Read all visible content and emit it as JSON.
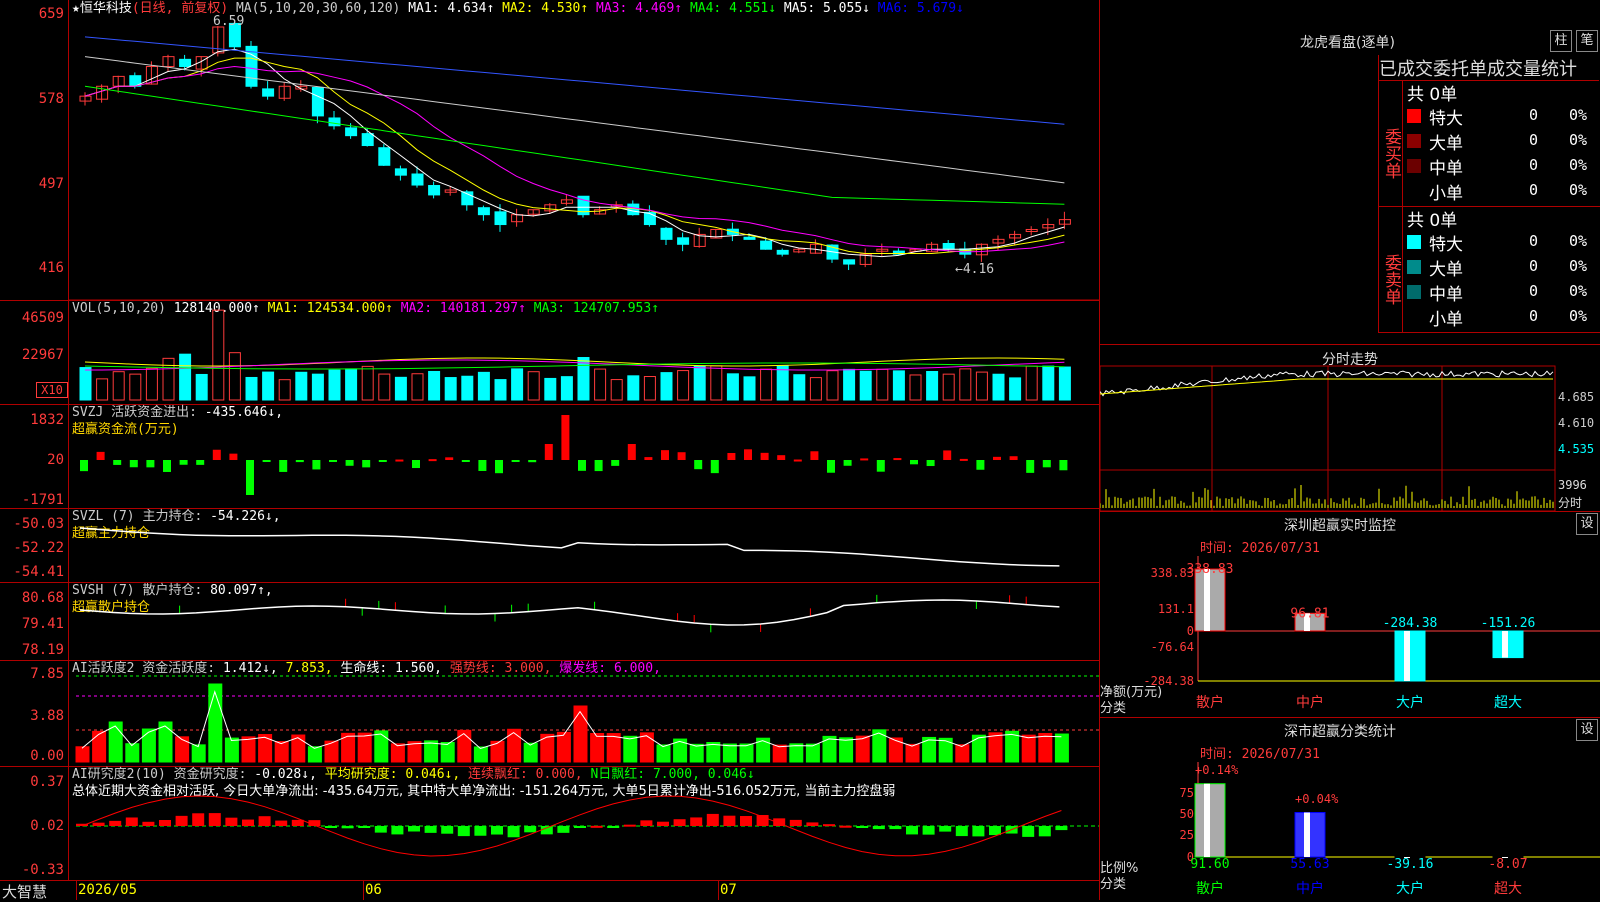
{
  "stock": {
    "marker": "★",
    "name": "恒华科技",
    "mode": "(日线, 前复权)"
  },
  "kline": {
    "high_label": "6.59",
    "low_label": "←4.16",
    "ma_hdr": "MA(5,10,20,30,60,120)",
    "ma": [
      {
        "k": "MA1:",
        "v": "4.634↑",
        "c": "#ffffff"
      },
      {
        "k": "MA2:",
        "v": "4.530↑",
        "c": "#ffff00"
      },
      {
        "k": "MA3:",
        "v": "4.469↑",
        "c": "#ff00ff"
      },
      {
        "k": "MA4:",
        "v": "4.551↓",
        "c": "#00ff00"
      },
      {
        "k": "MA5:",
        "v": "5.055↓",
        "c": "#ffffff"
      },
      {
        "k": "MA6:",
        "v": "5.679↓",
        "c": "#0000ff"
      }
    ],
    "ylabels": [
      "659",
      "578",
      "497",
      "416"
    ]
  },
  "vol": {
    "hdr": "VOL(5,10,20)",
    "val": "128140.000↑",
    "ma": [
      {
        "k": "MA1:",
        "v": "124534.000↑",
        "c": "#ffff00"
      },
      {
        "k": "MA2:",
        "v": "140181.297↑",
        "c": "#ff00ff"
      },
      {
        "k": "MA3:",
        "v": "124707.953↑",
        "c": "#00ff00"
      }
    ],
    "ylabels": [
      "46509",
      "22967"
    ],
    "unit": "X10"
  },
  "svzj": {
    "hdr": "SVZJ  活跃资金进出:",
    "val": "-435.646↓,",
    "sub": "超赢资金流(万元)",
    "ylabels": [
      "1832",
      "20",
      "-1791"
    ]
  },
  "svzl": {
    "hdr": "SVZL (7) 主力持仓:",
    "val": "-54.226↓,",
    "sub": "超赢主力持仓",
    "ylabels": [
      "-50.03",
      "-52.22",
      "-54.41"
    ]
  },
  "svsh": {
    "hdr": "SVSH (7) 散户持仓:",
    "val": "80.097↑,",
    "sub": "超赢散户持仓",
    "ylabels": [
      "80.68",
      "79.41",
      "78.19"
    ]
  },
  "ai1": {
    "hdr": "AI活跃度2 资金活跃度:",
    "v1": "1.412↓,",
    "v2": "7.853,",
    "life": "生命线: 1.560,",
    "strong": "强势线: 3.000,",
    "burst": "爆发线: 6.000,",
    "ylabels": [
      "7.85",
      "3.88",
      "0.00"
    ]
  },
  "ai2": {
    "hdr": "AI研究度2(10) 资金研究度:",
    "v1": "-0.028↓,",
    "avg": "平均研究度: 0.046↓,",
    "cont": "连续飘红: 0.000,",
    "nday": "N日飘红: 7.000, 0.046↓",
    "desc": "总体近期大资金相对活跃, 今日大单净流出: -435.64万元, 其中特大单净流出: -151.264万元, 大单5日累计净出-516.052万元, 当前主力控盘弱",
    "ylabels": [
      "0.37",
      "0.02",
      "-0.33"
    ]
  },
  "xaxis": {
    "brand": "大智慧",
    "labels": [
      "2026/05",
      "06",
      "07"
    ]
  },
  "lhb": {
    "title": "龙虎看盘(逐单)",
    "btn1": "柱",
    "btn2": "笔",
    "sub": "已成交委托单成交量统计",
    "buy": {
      "label": "委买单",
      "total": "共 0单",
      "rows": [
        {
          "n": "特大",
          "v": "0",
          "p": "0%",
          "c": "#ff0000"
        },
        {
          "n": "大单",
          "v": "0",
          "p": "0%",
          "c": "#8b0000"
        },
        {
          "n": "中单",
          "v": "0",
          "p": "0%",
          "c": "#6b0000"
        },
        {
          "n": "小单",
          "v": "0",
          "p": "0%",
          "c": "#000000"
        }
      ]
    },
    "sell": {
      "label": "委卖单",
      "total": "共 0单",
      "rows": [
        {
          "n": "特大",
          "v": "0",
          "p": "0%",
          "c": "#00ffff"
        },
        {
          "n": "大单",
          "v": "0",
          "p": "0%",
          "c": "#008b8b"
        },
        {
          "n": "中单",
          "v": "0",
          "p": "0%",
          "c": "#006b6b"
        },
        {
          "n": "小单",
          "v": "0",
          "p": "0%",
          "c": "#000000"
        }
      ]
    }
  },
  "intraday": {
    "title": "分时走势",
    "ylabels": [
      "4.685",
      "4.610",
      "4.535"
    ],
    "vol": "3996",
    "unit": "分时"
  },
  "sz_monitor": {
    "title": "深圳超赢实时监控",
    "set": "设",
    "time": "时间: 2026/07/31",
    "ylabels": [
      "338.83",
      "131.1",
      "0",
      "-76.64",
      "-284.38"
    ],
    "ylab": "净额(万元)",
    "xlab": "分类",
    "chart_data": {
      "type": "bar",
      "categories": [
        "散户",
        "中户",
        "大户",
        "超大"
      ],
      "values": [
        338.83,
        96.81,
        -284.38,
        -151.26
      ],
      "ylim": [
        -284.38,
        338.83
      ]
    },
    "vlabels": [
      "338.83",
      "96.81",
      "-284.38",
      "-151.26"
    ]
  },
  "sz_stat": {
    "title": "深市超赢分类统计",
    "set": "设",
    "time": "时间: 2026/07/31",
    "ylabels": [
      "75",
      "50",
      "25",
      "0"
    ],
    "ylab": "比例%",
    "xlab": "分类",
    "toplabels": [
      "+0.14%",
      "+0.04%"
    ],
    "chart_data": {
      "type": "bar",
      "categories": [
        "散户",
        "中户",
        "大户",
        "超大"
      ],
      "values": [
        91.6,
        55.63,
        -39.16,
        -8.07
      ],
      "ylim": [
        0,
        100
      ]
    },
    "vlabels": [
      "91.60",
      "55.63",
      "-39.16",
      "-8.07"
    ]
  }
}
